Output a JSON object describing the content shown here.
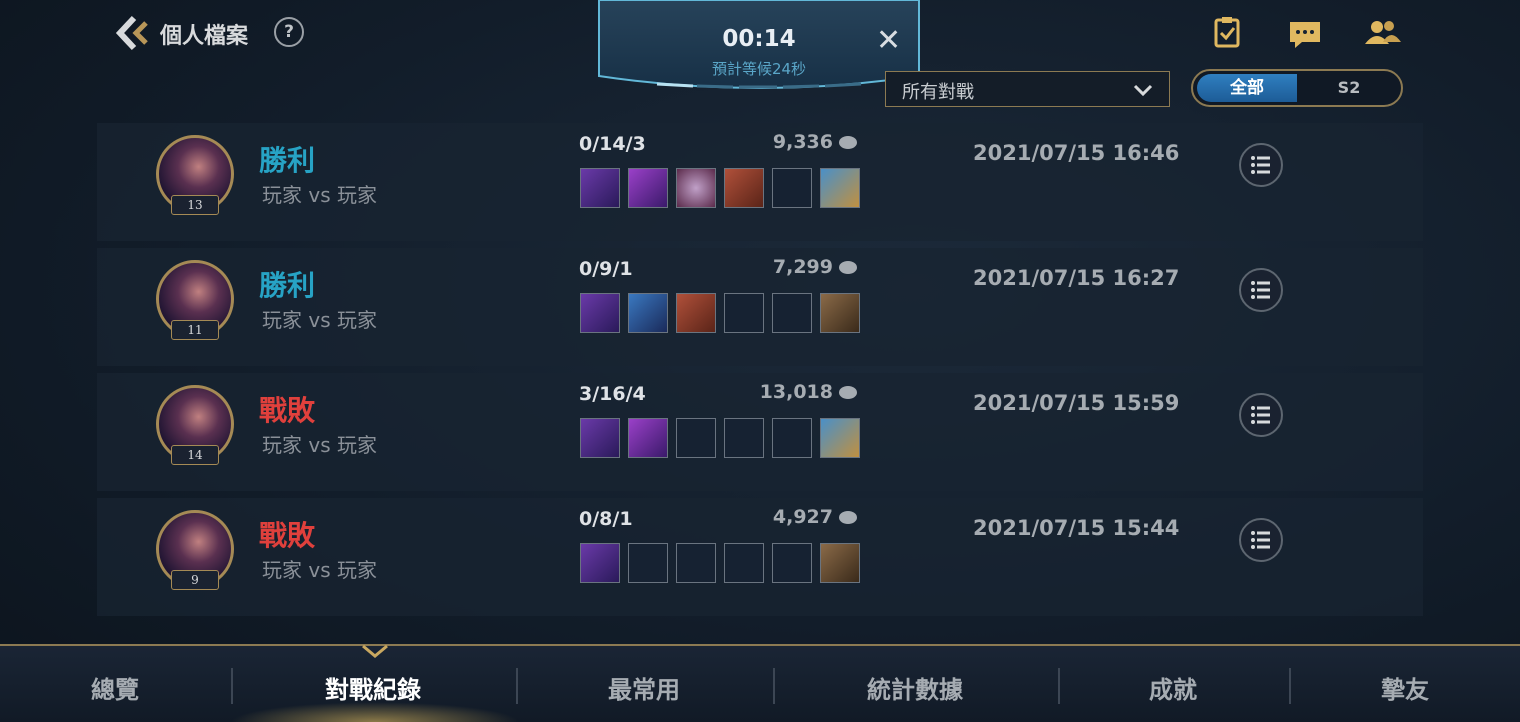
{
  "header": {
    "title": "個人檔案",
    "help_label": "?"
  },
  "queue": {
    "timer": "00:14",
    "estimate": "預計等候24秒",
    "close_label": "✕"
  },
  "filter": {
    "selected": "所有對戰"
  },
  "season_toggle": {
    "options": [
      "全部",
      "S2"
    ],
    "selected": "全部"
  },
  "matches": [
    {
      "result": "勝利",
      "outcome": "win",
      "mode": "玩家 vs 玩家",
      "level": "13",
      "kda": "0/14/3",
      "gold": "9,336",
      "datetime": "2021/07/15 16:46"
    },
    {
      "result": "勝利",
      "outcome": "win",
      "mode": "玩家 vs 玩家",
      "level": "11",
      "kda": "0/9/1",
      "gold": "7,299",
      "datetime": "2021/07/15 16:27"
    },
    {
      "result": "戰敗",
      "outcome": "loss",
      "mode": "玩家 vs 玩家",
      "level": "14",
      "kda": "3/16/4",
      "gold": "13,018",
      "datetime": "2021/07/15 15:59"
    },
    {
      "result": "戰敗",
      "outcome": "loss",
      "mode": "玩家 vs 玩家",
      "level": "9",
      "kda": "0/8/1",
      "gold": "4,927",
      "datetime": "2021/07/15 15:44"
    }
  ],
  "bottom_tabs": [
    {
      "label": "總覽"
    },
    {
      "label": "對戰紀錄"
    },
    {
      "label": "最常用"
    },
    {
      "label": "統計數據"
    },
    {
      "label": "成就"
    },
    {
      "label": "摯友"
    }
  ],
  "active_tab": "對戰紀錄",
  "colors": {
    "win": "#27a3c5",
    "loss": "#e0403c",
    "accent_gold": "#8c7a52",
    "toggle_active": "#2f7fc0"
  },
  "icons": [
    "back-arrow-icon",
    "help-icon",
    "clipboard-check-icon",
    "chat-icon",
    "friends-icon",
    "chevron-down-icon",
    "list-detail-icon",
    "coin-icon"
  ]
}
